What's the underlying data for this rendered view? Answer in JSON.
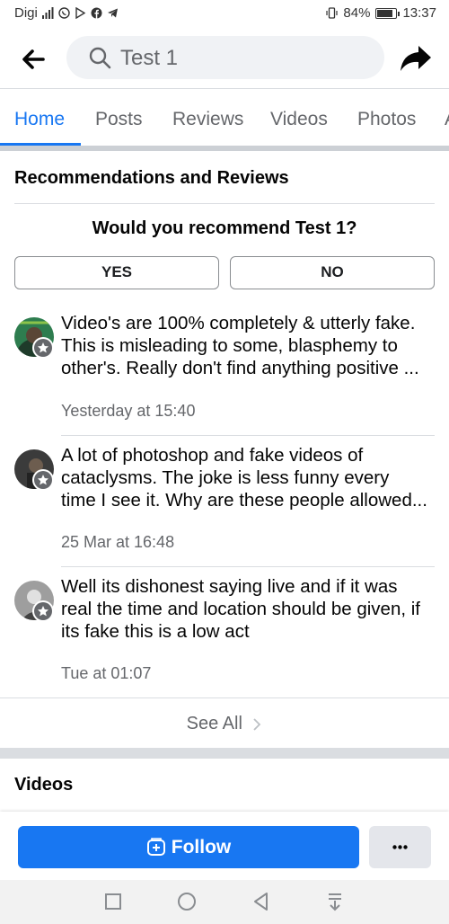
{
  "status_bar": {
    "carrier": "Digi",
    "battery": "84%",
    "battery_level": 0.84,
    "time": "13:37",
    "icons": [
      "signal-icon",
      "whatsapp-icon",
      "play-icon",
      "facebook-icon",
      "telegram-icon",
      "vibrate-icon"
    ]
  },
  "header": {
    "search_text": "Test 1",
    "icons": [
      "back-arrow-icon",
      "search-icon",
      "share-icon"
    ]
  },
  "tabs": [
    {
      "label": "Home",
      "active": true
    },
    {
      "label": "Posts",
      "active": false
    },
    {
      "label": "Reviews",
      "active": false
    },
    {
      "label": "Videos",
      "active": false
    },
    {
      "label": "Photos",
      "active": false
    },
    {
      "label": "A",
      "active": false
    }
  ],
  "recommendations": {
    "title": "Recommendations and Reviews",
    "question": "Would you recommend Test 1?",
    "yes_label": "YES",
    "no_label": "NO",
    "reviews": [
      {
        "lines": [
          "Video's are 100% completely & utterly fake.",
          "This is misleading to some,  blasphemy to",
          "other's.  Really don't find anything positive ..."
        ],
        "time": "Yesterday at 15:40"
      },
      {
        "lines": [
          "A lot of photoshop and fake videos of",
          "cataclysms. The joke is less funny every",
          "time I see it. Why are these people allowed..."
        ],
        "time": "25 Mar at 16:48"
      },
      {
        "lines": [
          "Well its dishonest saying live and if it was",
          "real the time and location should be given, if",
          "its fake this is a low act"
        ],
        "time": "Tue at 01:07"
      }
    ],
    "see_all_label": "See All"
  },
  "videos": {
    "title": "Videos"
  },
  "actions": {
    "follow_label": "Follow",
    "more_label": "···"
  },
  "colors": {
    "accent": "#1877f2",
    "secondary_text": "#65676b",
    "divider": "#dadde1",
    "button_gray": "#e4e6eb"
  }
}
